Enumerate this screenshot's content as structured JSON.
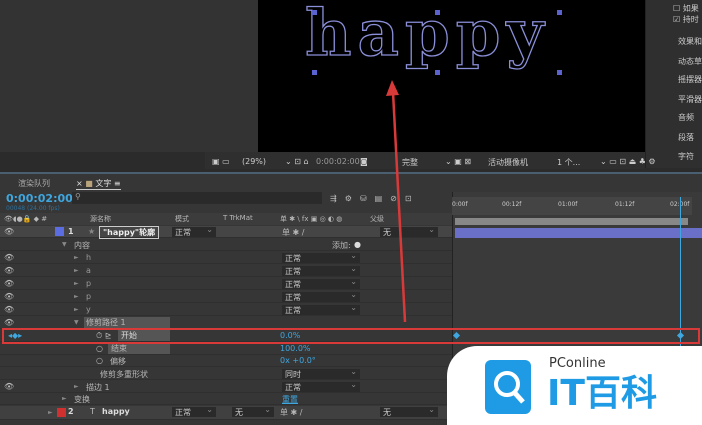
{
  "viewer": {
    "text": "happy",
    "zoom": "(29%)",
    "time": "0:00:02:00",
    "quality": "完整",
    "camera": "活动摄像机",
    "views": "1 个..."
  },
  "right_panel": {
    "check1": "如果",
    "check2": "持时",
    "items": [
      "效果和",
      "动态草图",
      "摇摆器",
      "平滑器",
      "音频",
      "段落",
      "字符"
    ]
  },
  "timeline": {
    "tabs": [
      "渲染队列",
      "文字"
    ],
    "timecode": "0:00:02:00",
    "fps": "00048 (24.00 fps)",
    "headers": {
      "name": "源名称",
      "mode": "模式",
      "trkmat": "T  TrkMat",
      "parent": "父级",
      "switches": "单 ✱ \\ fx ▣ ◎ ◐ ◍"
    },
    "ruler": [
      "0:00f",
      "00:12f",
      "01:00f",
      "01:12f",
      "02:00f"
    ],
    "layer1": {
      "num": "1",
      "name": "\"happy\"轮廓",
      "mode": "正常",
      "parent": "无"
    },
    "content": "内容",
    "add": "添加:",
    "shapes": [
      {
        "name": "h",
        "mode": "正常"
      },
      {
        "name": "a",
        "mode": "正常"
      },
      {
        "name": "p",
        "mode": "正常"
      },
      {
        "name": "p",
        "mode": "正常"
      },
      {
        "name": "y",
        "mode": "正常"
      }
    ],
    "trim": "修剪路径 1",
    "start_label": "开始",
    "start_value": "0.0%",
    "end_label": "结束",
    "end_value": "100.0%",
    "offset_label": "偏移",
    "offset_value": "0x +0.0°",
    "multi_label": "修剪多重形状",
    "multi_value": "同时",
    "stroke": "描边 1",
    "stroke_mode": "正常",
    "transform": "变换",
    "reset": "重置",
    "layer2": {
      "num": "2",
      "name": "happy",
      "mode": "正常",
      "trkmat": "无",
      "parent": "无"
    }
  },
  "logo": {
    "brand": "PConline",
    "name": "IT百科"
  },
  "colors": {
    "accent": "#3fa7e0",
    "highlight": "#d83a3a"
  }
}
